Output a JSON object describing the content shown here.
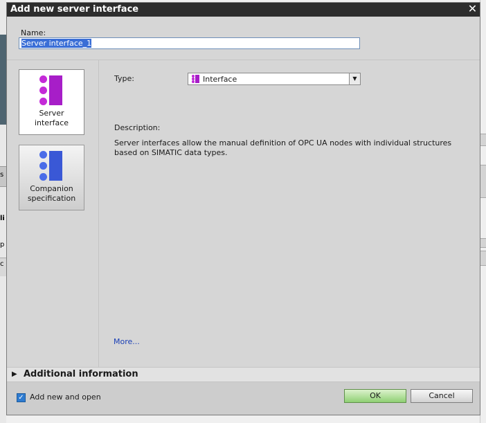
{
  "dialog": {
    "title": "Add new server interface",
    "close_glyph": "✕"
  },
  "name_field": {
    "label": "Name:",
    "value": "Server interface_1"
  },
  "tiles": [
    {
      "label_line1": "Server",
      "label_line2": "interface",
      "icon": "server-interface-icon",
      "color": "#b820d0",
      "selected": true
    },
    {
      "label_line1": "Companion",
      "label_line2": "specification",
      "icon": "companion-specification-icon",
      "color": "#3f5fe0",
      "selected": false
    }
  ],
  "type_field": {
    "label": "Type:",
    "value": "Interface",
    "dropdown_glyph": "▼"
  },
  "description": {
    "label": "Description:",
    "text": "Server interfaces allow the manual definition of OPC UA nodes with individual structures based on SIMATIC data types."
  },
  "more_link": "More...",
  "additional_info": {
    "arrow_glyph": "▶",
    "label": "Additional information"
  },
  "footer": {
    "checkbox_checked": true,
    "check_glyph": "✓",
    "checkbox_label": "Add new and open",
    "ok_label": "OK",
    "cancel_label": "Cancel"
  },
  "background": {
    "left_fragments": [
      "s",
      "li",
      "p",
      "c"
    ],
    "colors": {
      "title_bar": "#2d2d2d",
      "ok_green": "#8fcf74",
      "selection": "#3a6ed6"
    }
  }
}
